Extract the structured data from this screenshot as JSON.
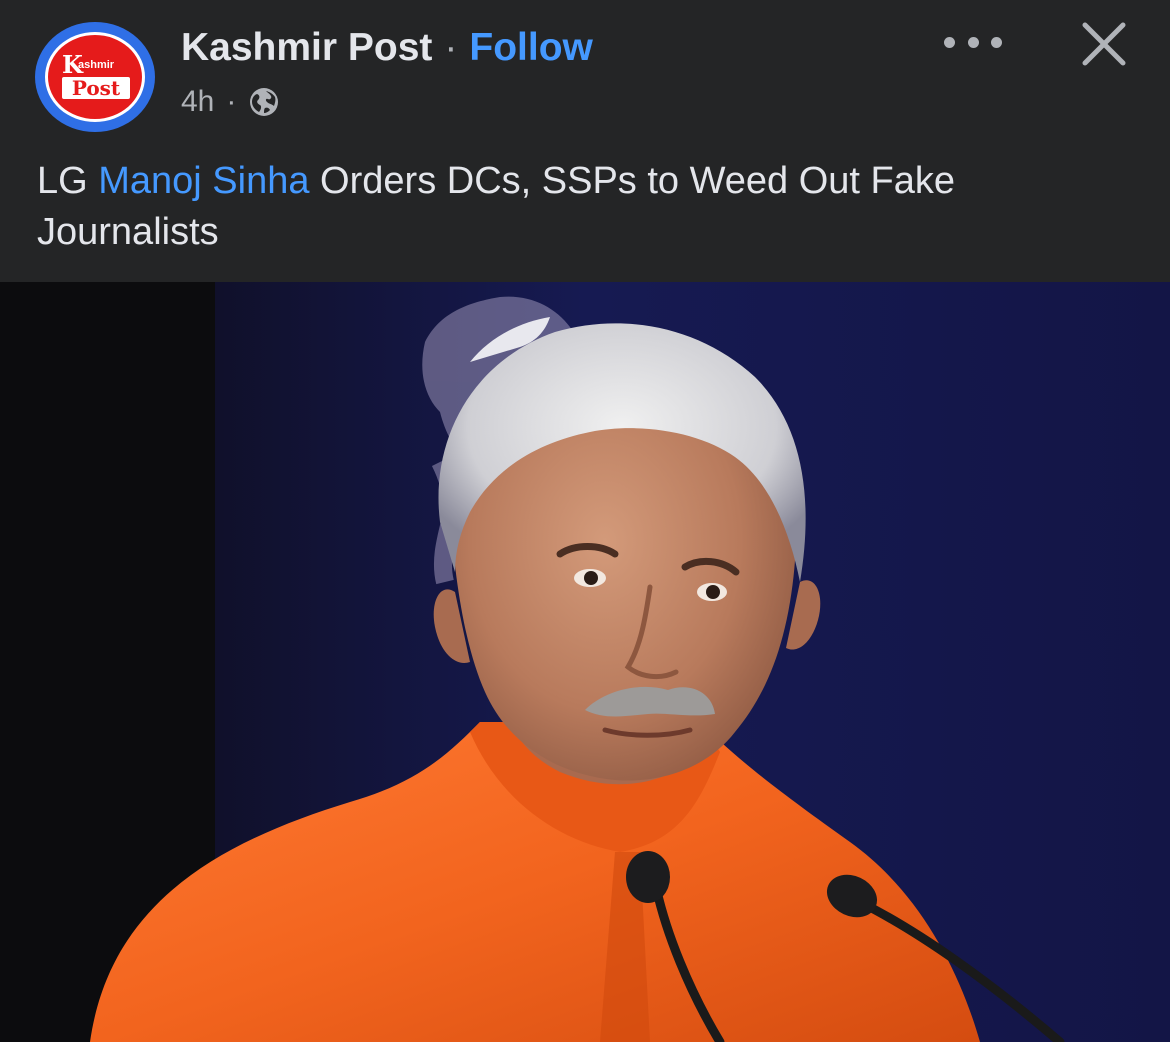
{
  "post": {
    "page_name": "Kashmir Post",
    "separator": "·",
    "follow_label": "Follow",
    "time": "4h",
    "meta_separator": "·",
    "audience_icon": "globe-icon",
    "more_icon": "more-horizontal-icon",
    "close_icon": "close-icon",
    "headline": {
      "prefix": "LG ",
      "mention": "Manoj Sinha",
      "suffix": " Orders DCs, SSPs to Weed Out Fake Journalists"
    },
    "avatar": {
      "logo_k": "K",
      "logo_small": "ashmir",
      "logo_post": "Post"
    }
  },
  "colors": {
    "background": "#242526",
    "text_primary": "#e4e6eb",
    "text_secondary": "#b0b3b8",
    "link_blue": "#4599ff",
    "avatar_ring": "#2f6fe6",
    "logo_red": "#e51b1b",
    "kurta_orange": "#f2641e"
  }
}
